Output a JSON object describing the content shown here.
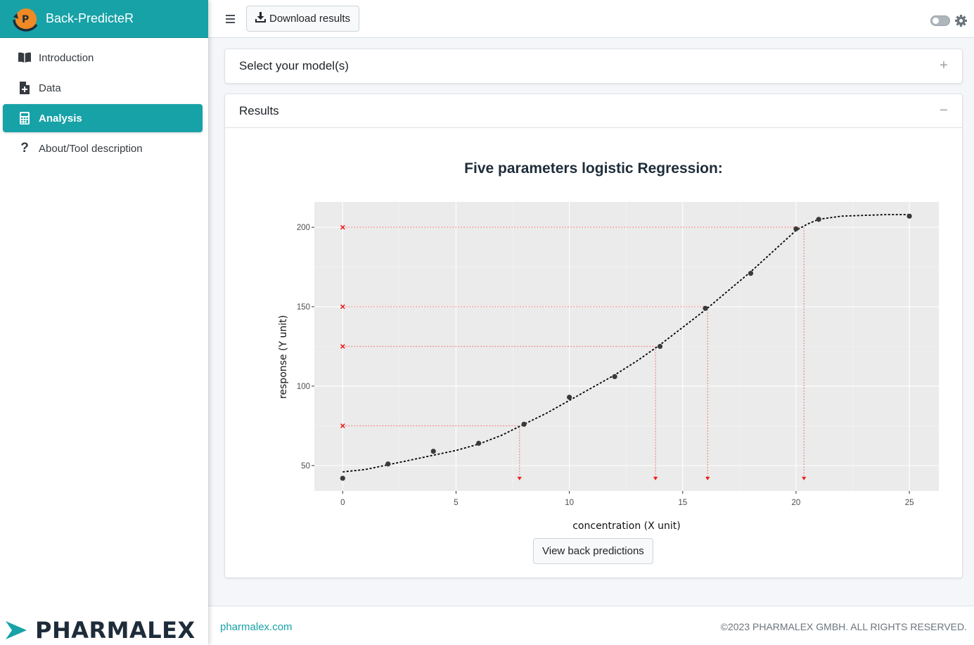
{
  "app": {
    "title": "Back-PredicteR",
    "logo_letter": "P"
  },
  "sidebar": {
    "items": [
      {
        "label": "Introduction",
        "icon": "book-icon",
        "active": false
      },
      {
        "label": "Data",
        "icon": "file-plus-icon",
        "active": false
      },
      {
        "label": "Analysis",
        "icon": "calculator-icon",
        "active": true
      },
      {
        "label": "About/Tool description",
        "icon": "question-icon",
        "active": false
      }
    ],
    "footer_logo_text": "PHARMALEX"
  },
  "toolbar": {
    "download_label": "Download results"
  },
  "cards": {
    "models": {
      "title": "Select your model(s)",
      "tool": "+"
    },
    "results": {
      "title": "Results",
      "tool": "−"
    }
  },
  "results": {
    "view_button_label": "View back predictions"
  },
  "footer": {
    "link": "pharmalex.com",
    "copyright": "©2023 PHARMALEX GMBH. ALL RIGHTS RESERVED."
  },
  "colors": {
    "accent": "#17a2a8",
    "logo_orange": "#f08a24",
    "logo_navy": "#1e2c3a",
    "plot_bg": "#ebebeb",
    "back_pred": "#e8231f"
  },
  "chart_data": {
    "type": "scatter",
    "title": "Five parameters logistic Regression:",
    "xlabel": "concentration (X unit)",
    "ylabel": "response (Y unit)",
    "xlim": [
      -1.25,
      26.3
    ],
    "ylim": [
      34,
      216
    ],
    "x_ticks": [
      0,
      5,
      10,
      15,
      20,
      25
    ],
    "y_ticks": [
      50,
      100,
      150,
      200
    ],
    "grid": true,
    "points": {
      "x": [
        0,
        2,
        4,
        6,
        8,
        10,
        12,
        14,
        16,
        18,
        20,
        21,
        25
      ],
      "y": [
        42,
        51,
        59,
        64,
        76,
        93,
        106,
        125,
        149,
        171,
        199,
        205,
        207
      ]
    },
    "fit_curve": {
      "x": [
        0,
        1,
        2,
        3,
        4,
        5,
        6,
        7,
        8,
        9,
        10,
        11,
        12,
        13,
        14,
        15,
        16,
        17,
        18,
        19,
        20,
        20.5,
        21,
        22,
        23,
        24,
        25
      ],
      "y": [
        46,
        47.5,
        50.5,
        53.5,
        56.5,
        59.5,
        63.5,
        69,
        76,
        83,
        91,
        99,
        107,
        116,
        126,
        137,
        148,
        160,
        172,
        185,
        198,
        202,
        205,
        207,
        207.5,
        208,
        208
      ]
    },
    "back_predictions": [
      {
        "response": 75,
        "concentration": 7.8
      },
      {
        "response": 125,
        "concentration": 13.8
      },
      {
        "response": 150,
        "concentration": 16.1
      },
      {
        "response": 200,
        "concentration": 20.35
      }
    ]
  }
}
